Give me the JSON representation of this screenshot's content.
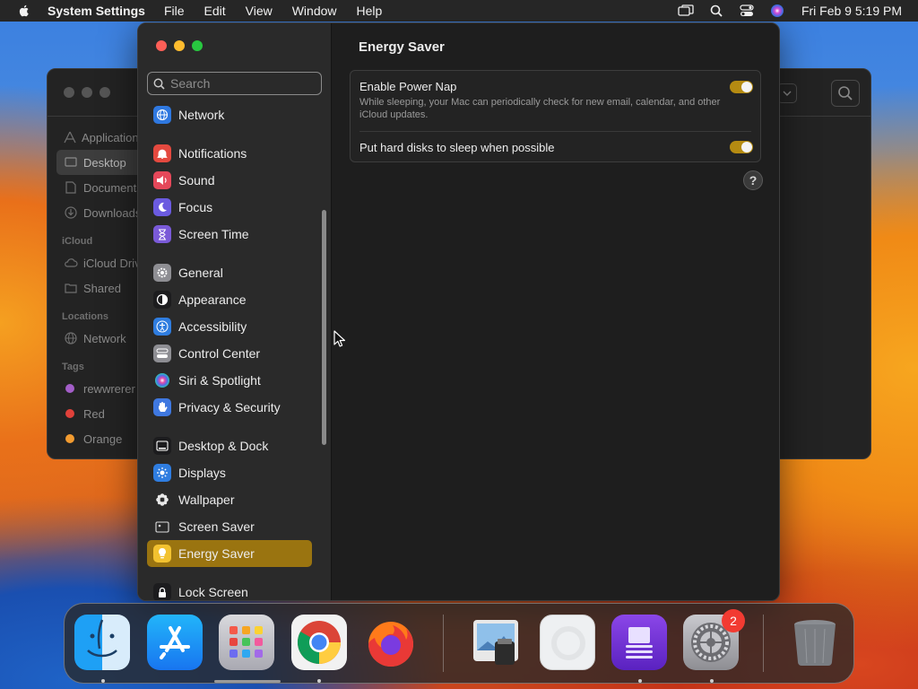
{
  "menubar": {
    "app_name": "System Settings",
    "menus": [
      "File",
      "Edit",
      "View",
      "Window",
      "Help"
    ],
    "clock": "Fri Feb 9  5:19 PM"
  },
  "finder": {
    "favorites": [
      "Applications",
      "Desktop",
      "Documents",
      "Downloads"
    ],
    "icloud_header": "iCloud",
    "icloud": [
      "iCloud Drive",
      "Shared"
    ],
    "locations_header": "Locations",
    "locations": [
      "Network"
    ],
    "tags_header": "Tags",
    "tags": [
      {
        "label": "rewwrerer",
        "color": "#a35ec8"
      },
      {
        "label": "Red",
        "color": "#e0413a"
      },
      {
        "label": "Orange",
        "color": "#f29b30"
      }
    ]
  },
  "settings": {
    "search_placeholder": "Search",
    "sidebar": [
      {
        "label": "Network",
        "icon": "globe-icon",
        "color": "#2f78e0"
      },
      {
        "label": "Notifications",
        "icon": "bell-icon",
        "color": "#e4493f"
      },
      {
        "label": "Sound",
        "icon": "speaker-icon",
        "color": "#e5485a"
      },
      {
        "label": "Focus",
        "icon": "moon-icon",
        "color": "#6b5be0"
      },
      {
        "label": "Screen Time",
        "icon": "hourglass-icon",
        "color": "#7a5ad8"
      },
      {
        "label": "General",
        "icon": "gear-icon",
        "color": "#8e8e93"
      },
      {
        "label": "Appearance",
        "icon": "appearance-icon",
        "color": "#1c1c1e"
      },
      {
        "label": "Accessibility",
        "icon": "accessibility-icon",
        "color": "#2f7de0"
      },
      {
        "label": "Control Center",
        "icon": "control-center-icon",
        "color": "#8e8e93"
      },
      {
        "label": "Siri & Spotlight",
        "icon": "siri-icon",
        "color": "#b03ac0"
      },
      {
        "label": "Privacy & Security",
        "icon": "hand-icon",
        "color": "#3f78e0"
      },
      {
        "label": "Desktop & Dock",
        "icon": "dock-icon",
        "color": "#1c1c1e"
      },
      {
        "label": "Displays",
        "icon": "sun-icon",
        "color": "#2f7de0"
      },
      {
        "label": "Wallpaper",
        "icon": "flower-icon",
        "color": "#2ea8d8"
      },
      {
        "label": "Screen Saver",
        "icon": "screen-saver-icon",
        "color": "#3ab5c8"
      },
      {
        "label": "Energy Saver",
        "icon": "lightbulb-icon",
        "color": "#f2c230"
      },
      {
        "label": "Lock Screen",
        "icon": "lock-icon",
        "color": "#1c1c1e"
      }
    ],
    "selected": "Energy Saver",
    "content": {
      "title": "Energy Saver",
      "power_nap_label": "Enable Power Nap",
      "power_nap_desc": "While sleeping, your Mac can periodically check for new email, calendar, and other iCloud updates.",
      "power_nap_on": true,
      "disk_sleep_label": "Put hard disks to sleep when possible",
      "disk_sleep_on": true,
      "help": "?"
    }
  },
  "dock": {
    "apps": [
      "Finder",
      "App Store",
      "Launchpad",
      "Google Chrome",
      "Firefox",
      "Preview",
      "System Settings placeholder",
      "Screen Recorder",
      "System Settings",
      "Trash"
    ],
    "settings_badge": "2"
  }
}
